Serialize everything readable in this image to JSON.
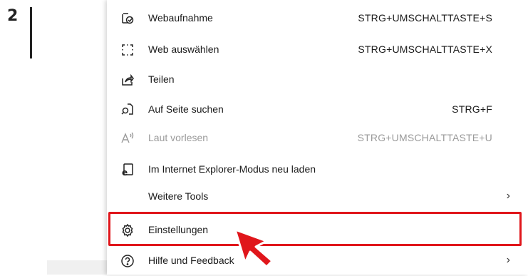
{
  "step": {
    "number": "2"
  },
  "menu": {
    "items": [
      {
        "label": "Webaufnahme",
        "shortcut": "STRG+UMSCHALTTASTE+S",
        "icon": "web-capture-icon"
      },
      {
        "label": "Web auswählen",
        "shortcut": "STRG+UMSCHALTTASTE+X",
        "icon": "web-select-icon"
      },
      {
        "label": "Teilen",
        "shortcut": "",
        "icon": "share-icon"
      },
      {
        "label": "Auf Seite suchen",
        "shortcut": "STRG+F",
        "icon": "find-on-page-icon"
      },
      {
        "label": "Laut vorlesen",
        "shortcut": "STRG+UMSCHALTTASTE+U",
        "icon": "read-aloud-icon",
        "disabled": true
      },
      {
        "label": "Im Internet Explorer-Modus neu laden",
        "shortcut": "",
        "icon": "ie-mode-icon"
      },
      {
        "label": "Weitere Tools",
        "shortcut": "",
        "icon": "",
        "submenu_indicator": "›"
      },
      {
        "label": "Einstellungen",
        "shortcut": "",
        "icon": "settings-gear-icon"
      },
      {
        "label": "Hilfe und Feedback",
        "shortcut": "",
        "icon": "help-icon",
        "submenu_indicator": "›"
      }
    ]
  },
  "colors": {
    "highlight": "#e0161b",
    "cursor": "#e0161b",
    "disabled_text": "#9a9a9a"
  }
}
